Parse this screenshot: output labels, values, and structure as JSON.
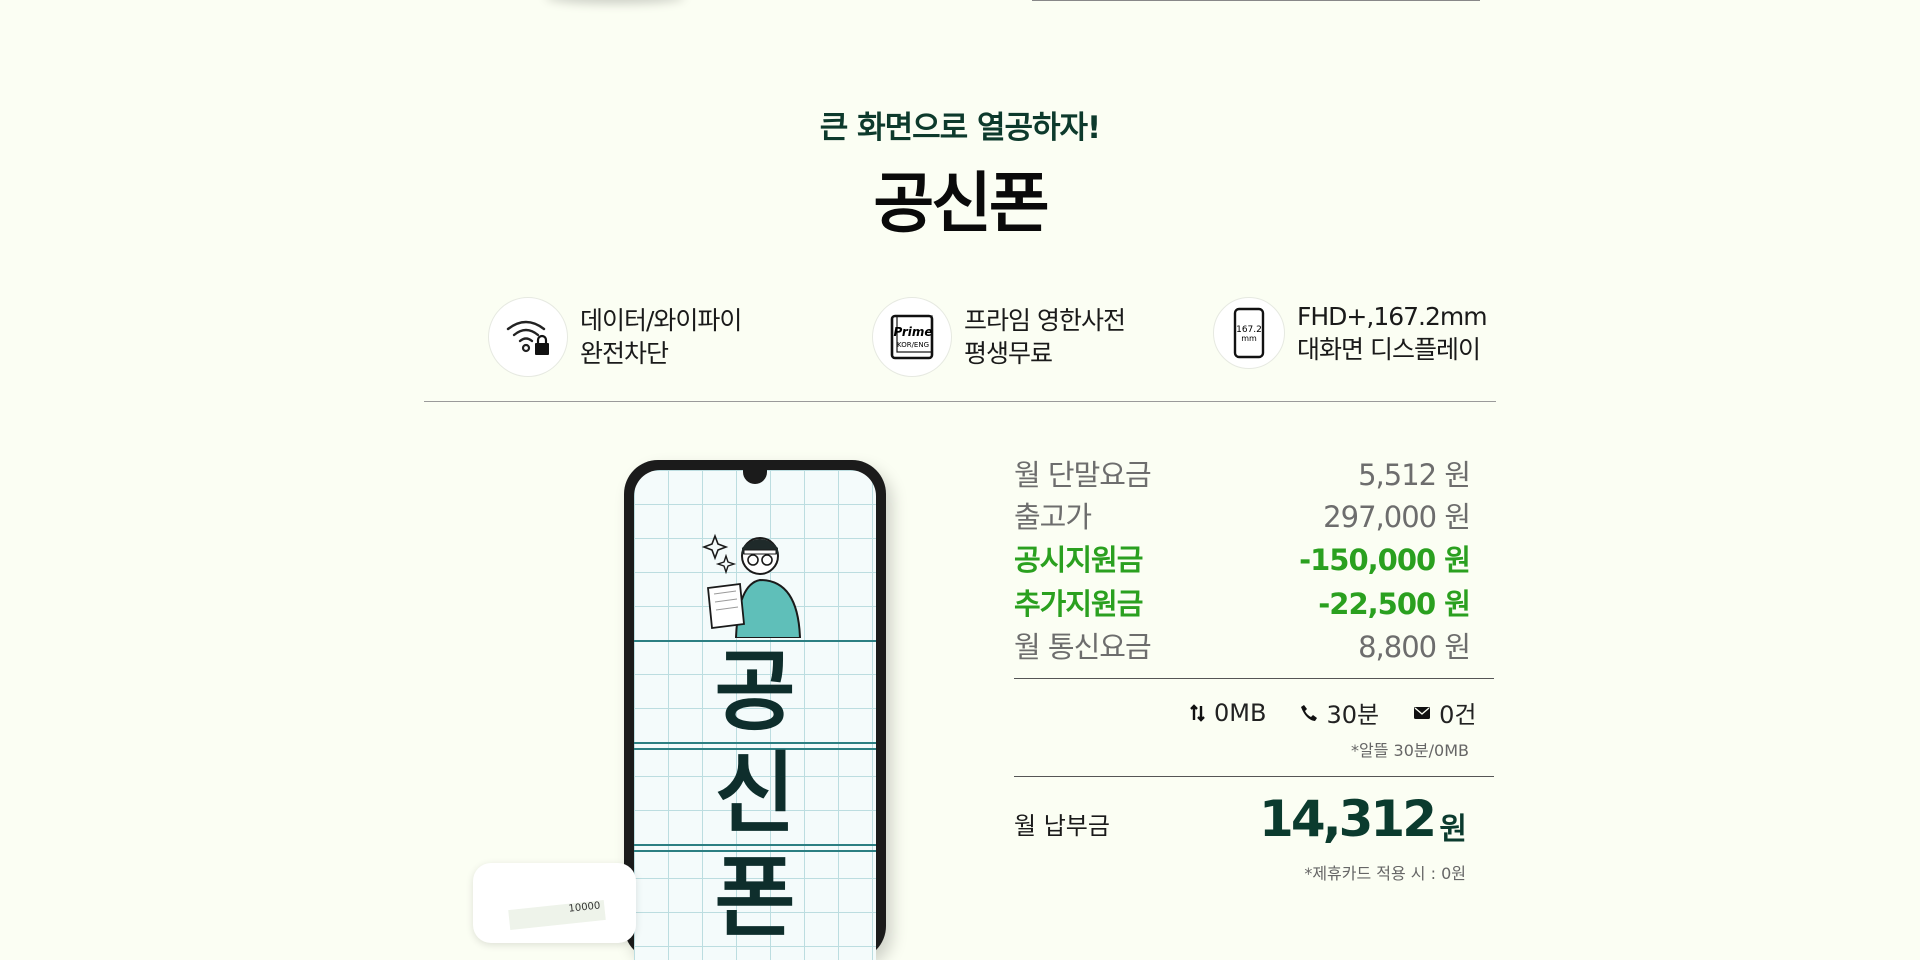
{
  "header": {
    "eyebrow": "큰 화면으로 열공하자!",
    "title": "공신폰"
  },
  "features": [
    {
      "icon": "wifi-lock-icon",
      "line1": "데이터/와이파이",
      "line2": "완전차단"
    },
    {
      "icon": "prime-dictionary-icon",
      "icon_text1": "Prime",
      "icon_text2": "KOR/ENG",
      "line1": "프라임 영한사전",
      "line2": "평생무료"
    },
    {
      "icon": "phone-size-icon",
      "icon_text1": "167.2",
      "icon_text2": "mm",
      "line1": "FHD+,167.2mm",
      "line2": "대화면 디스플레이"
    }
  ],
  "phone": {
    "screen_chars": [
      "공",
      "신",
      "폰"
    ]
  },
  "card": {
    "ticket_text": "10000"
  },
  "prices": [
    {
      "label": "월 단말요금",
      "value": "5,512 원",
      "highlight": false
    },
    {
      "label": "출고가",
      "value": "297,000 원",
      "highlight": false
    },
    {
      "label": "공시지원금",
      "value": "-150,000 원",
      "highlight": true
    },
    {
      "label": "추가지원금",
      "value": "-22,500 원",
      "highlight": true
    },
    {
      "label": "월 통신요금",
      "value": "8,800 원",
      "highlight": false
    }
  ],
  "usage": [
    {
      "icon": "data-transfer-icon",
      "value": "0MB"
    },
    {
      "icon": "phone-call-icon",
      "value": "30분"
    },
    {
      "icon": "mail-icon",
      "value": "0건"
    }
  ],
  "usage_note": "*알뜰 30분/0MB",
  "payment": {
    "label": "월 납부금",
    "amount": "14,312",
    "unit": "원",
    "note": "*제휴카드 적용 시 : 0원"
  },
  "colors": {
    "background": "#fbfef3",
    "brand_dark_green": "#0b3b2e",
    "discount_green": "#2aa01f"
  }
}
